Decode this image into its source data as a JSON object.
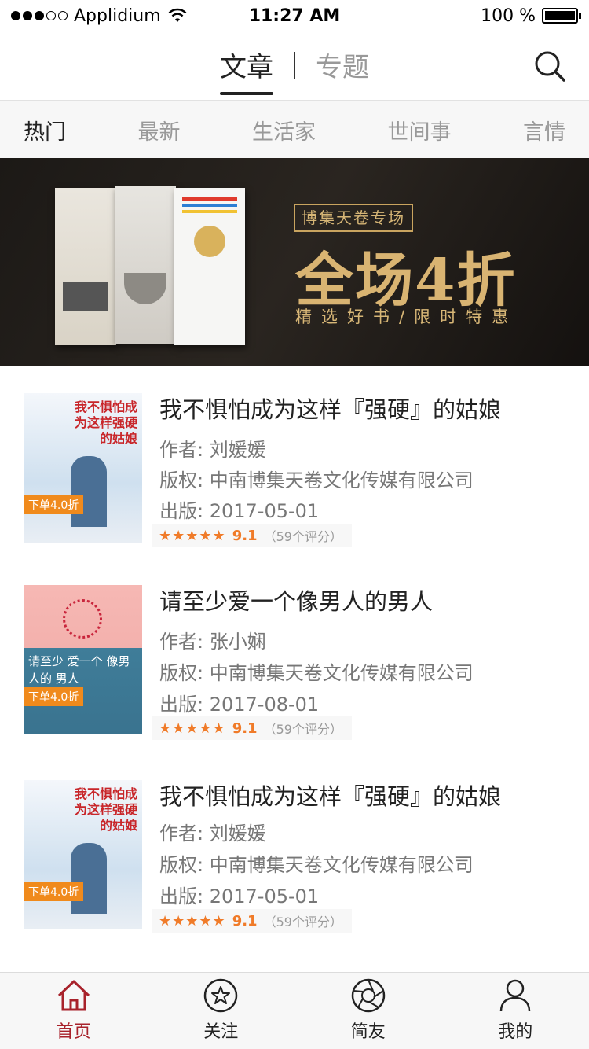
{
  "status": {
    "carrier": "Applidium",
    "time": "11:27 AM",
    "battery": "100 %",
    "battery_level": 1.0
  },
  "header": {
    "tabs": [
      {
        "label": "文章",
        "active": true
      },
      {
        "label": "专题",
        "active": false
      }
    ],
    "search_icon": "search-icon"
  },
  "categories": [
    {
      "label": "热门",
      "active": true
    },
    {
      "label": "最新",
      "active": false
    },
    {
      "label": "生活家",
      "active": false
    },
    {
      "label": "世间事",
      "active": false
    },
    {
      "label": "言情",
      "active": false
    }
  ],
  "banner": {
    "tag": "博集天卷专场",
    "title": "全场4折",
    "subtitle": "精选好书/限时特惠"
  },
  "books": [
    {
      "title": "我不惧怕成为这样『强硬』的姑娘",
      "author": "作者: 刘媛媛",
      "copyright": "版权: 中南博集天卷文化传媒有限公司",
      "published": "出版: 2017-05-01",
      "stars": "★★★★★",
      "score": "9.1",
      "rating_count": "（59个评分）",
      "cover_badge": "下单4.0折",
      "cover_title": "我不惧怕成为这样强硬的姑娘"
    },
    {
      "title": "请至少爱一个像男人的男人",
      "author": "作者: 张小娴",
      "copyright": "版权: 中南博集天卷文化传媒有限公司",
      "published": "出版: 2017-08-01",
      "stars": "★★★★★",
      "score": "9.1",
      "rating_count": "（59个评分）",
      "cover_badge": "下单4.0折",
      "cover_title": "请至少 爱一个 像男人的 男人"
    },
    {
      "title": "我不惧怕成为这样『强硬』的姑娘",
      "author": "作者: 刘媛媛",
      "copyright": "版权: 中南博集天卷文化传媒有限公司",
      "published": "出版: 2017-05-01",
      "stars": "★★★★★",
      "score": "9.1",
      "rating_count": "（59个评分）",
      "cover_badge": "下单4.0折",
      "cover_title": "我不惧怕成为这样强硬的姑娘"
    }
  ],
  "tabbar": [
    {
      "label": "首页",
      "icon": "home-icon",
      "active": true
    },
    {
      "label": "关注",
      "icon": "star-icon",
      "active": false
    },
    {
      "label": "简友",
      "icon": "aperture-icon",
      "active": false
    },
    {
      "label": "我的",
      "icon": "user-icon",
      "active": false
    }
  ],
  "colors": {
    "accent": "#a8222b",
    "rating": "#f07b29",
    "banner_gold": "#d9b472"
  }
}
